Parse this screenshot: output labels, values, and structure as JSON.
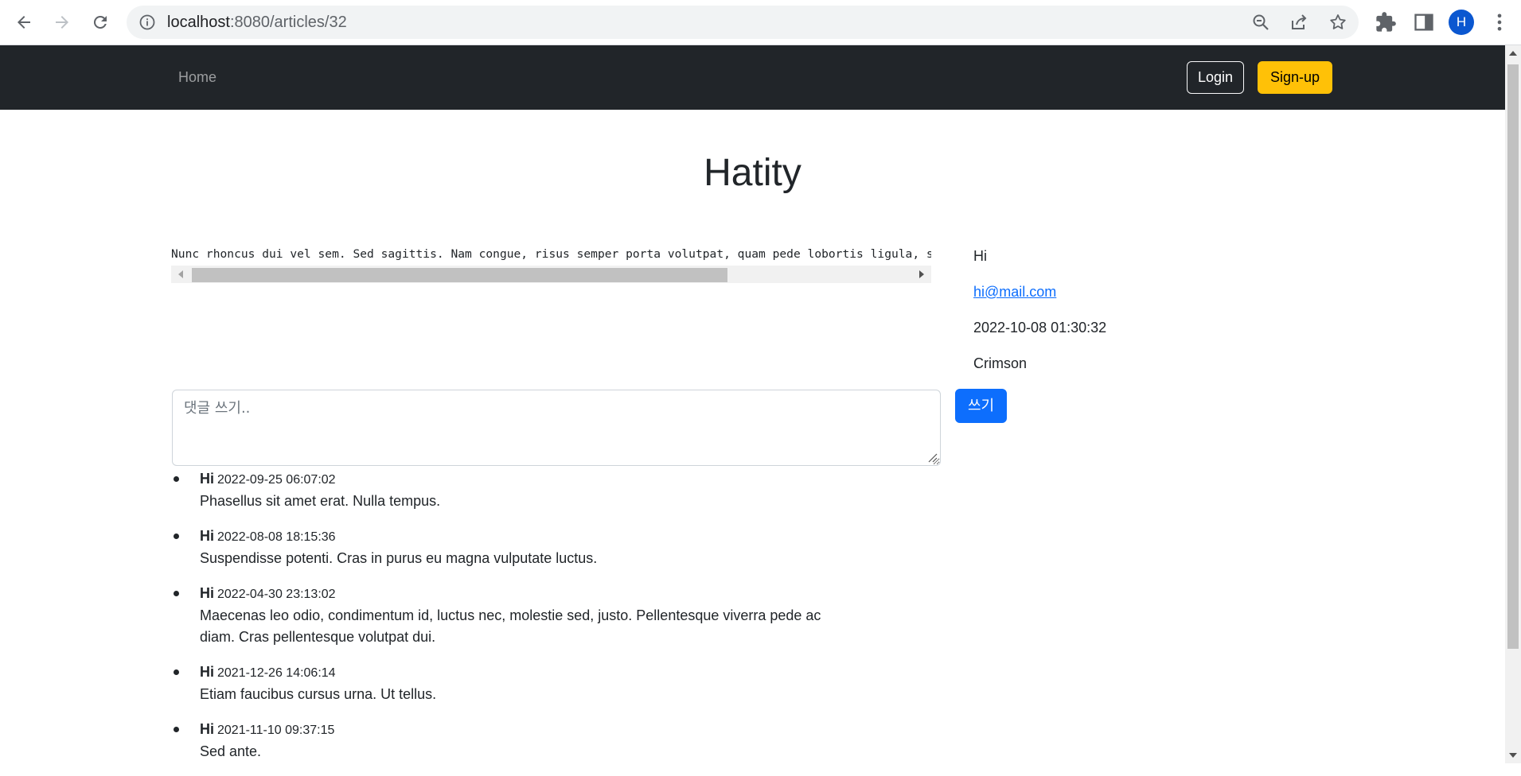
{
  "browser": {
    "url_host": "localhost",
    "url_path": ":8080/articles/32",
    "profile_initial": "H"
  },
  "navbar": {
    "home_label": "Home",
    "login_label": "Login",
    "signup_label": "Sign-up",
    "colors": {
      "background": "#212529",
      "signup": "#ffc107"
    }
  },
  "article": {
    "title": "Hatity",
    "content": "Nunc rhoncus dui vel sem. Sed sagittis. Nam congue, risus semper porta volutpat, quam pede lobortis ligula, sit amet eleifend pede libero quis orci.",
    "author": "Hi",
    "email": "hi@mail.com",
    "created_at": "2022-10-08 01:30:32",
    "hashtag": "Crimson"
  },
  "comment_form": {
    "placeholder": "댓글 쓰기..",
    "submit_label": "쓰기",
    "submit_color": "#0d6efd"
  },
  "comments": [
    {
      "author": "Hi",
      "time": "2022-09-25 06:07:02",
      "content": "Phasellus sit amet erat. Nulla tempus."
    },
    {
      "author": "Hi",
      "time": "2022-08-08 18:15:36",
      "content": "Suspendisse potenti. Cras in purus eu magna vulputate luctus."
    },
    {
      "author": "Hi",
      "time": "2022-04-30 23:13:02",
      "content": "Maecenas leo odio, condimentum id, luctus nec, molestie sed, justo. Pellentesque viverra pede ac diam. Cras pellentesque volutpat dui."
    },
    {
      "author": "Hi",
      "time": "2021-12-26 14:06:14",
      "content": "Etiam faucibus cursus urna. Ut tellus."
    },
    {
      "author": "Hi",
      "time": "2021-11-10 09:37:15",
      "content": "Sed ante."
    }
  ]
}
